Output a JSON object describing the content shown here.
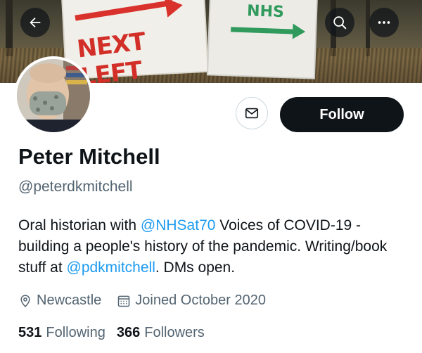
{
  "banner": {
    "sign_left_text": "NEXT LEFT",
    "sign_right_text": "NHS"
  },
  "profile": {
    "name": "Peter Mitchell",
    "handle": "@peterdkmitchell",
    "bio": {
      "part1": "Oral historian with ",
      "mention1": "@NHSat70",
      "part2": " Voices of COVID-19 - building a people's history of the pandemic. Writing/book stuff at ",
      "mention2": "@pdkmitchell",
      "part3": ". DMs open."
    },
    "location": "Newcastle",
    "joined": "Joined October 2020",
    "following_count": "531",
    "following_label": "Following",
    "followers_count": "366",
    "followers_label": "Followers"
  },
  "actions": {
    "follow_label": "Follow",
    "back_icon": "arrow-left-icon",
    "search_icon": "search-icon",
    "more_icon": "more-icon",
    "message_icon": "envelope-icon"
  },
  "colors": {
    "accent": "#1d9bf0",
    "follow_bg": "#0f1419",
    "secondary_text": "#536471"
  }
}
